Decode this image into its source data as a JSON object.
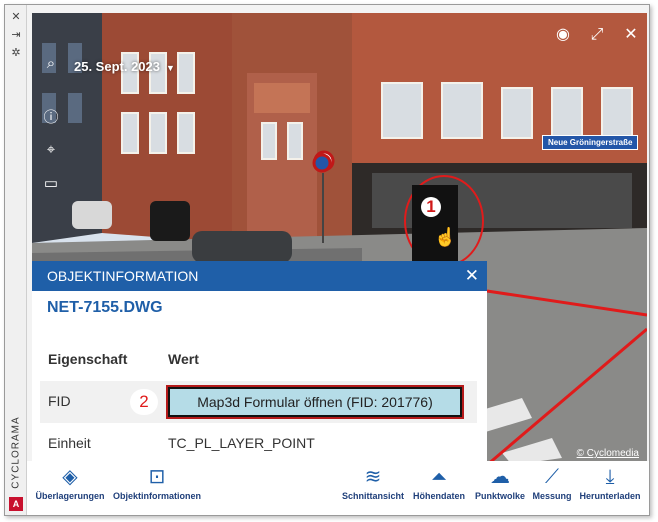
{
  "sidebar": {
    "title": "CYCLORAMA",
    "logo": "A"
  },
  "viewer": {
    "date": "25. Sept. 2023",
    "street_sign": "Neue Gröningerstraße",
    "copyright": "© Cyclomedia",
    "marker_number": "1",
    "annotation_number": "2",
    "top_icons": [
      "eye-icon",
      "expand-icon",
      "close-icon"
    ],
    "left_icons": [
      "search-image-icon",
      "info-icon",
      "crosshair-icon",
      "comment-icon"
    ]
  },
  "panel": {
    "title": "OBJEKTINFORMATION",
    "file_name": "NET-7155.DWG",
    "columns": [
      "Eigenschaft",
      "Wert"
    ],
    "rows": [
      {
        "property": "FID",
        "button_label": "Map3d Formular öffnen (FID: 201776)"
      },
      {
        "property": "Einheit",
        "value": "TC_PL_LAYER_POINT"
      }
    ]
  },
  "toolbar": {
    "left": [
      {
        "label": "Überlagerungen",
        "icon": "layers-icon"
      },
      {
        "label": "Objektinformationen",
        "icon": "object-info-icon"
      }
    ],
    "right": [
      {
        "label": "Schnittansicht",
        "icon": "section-view-icon"
      },
      {
        "label": "Höhendaten",
        "icon": "elevation-icon"
      },
      {
        "label": "Punktwolke",
        "icon": "point-cloud-icon"
      },
      {
        "label": "Messung",
        "icon": "ruler-icon"
      },
      {
        "label": "Herunterladen",
        "icon": "download-icon"
      }
    ]
  },
  "colors": {
    "accent": "#1f5fa8",
    "highlight_red": "#e01b1b",
    "fid_button": "#b5dce7"
  }
}
